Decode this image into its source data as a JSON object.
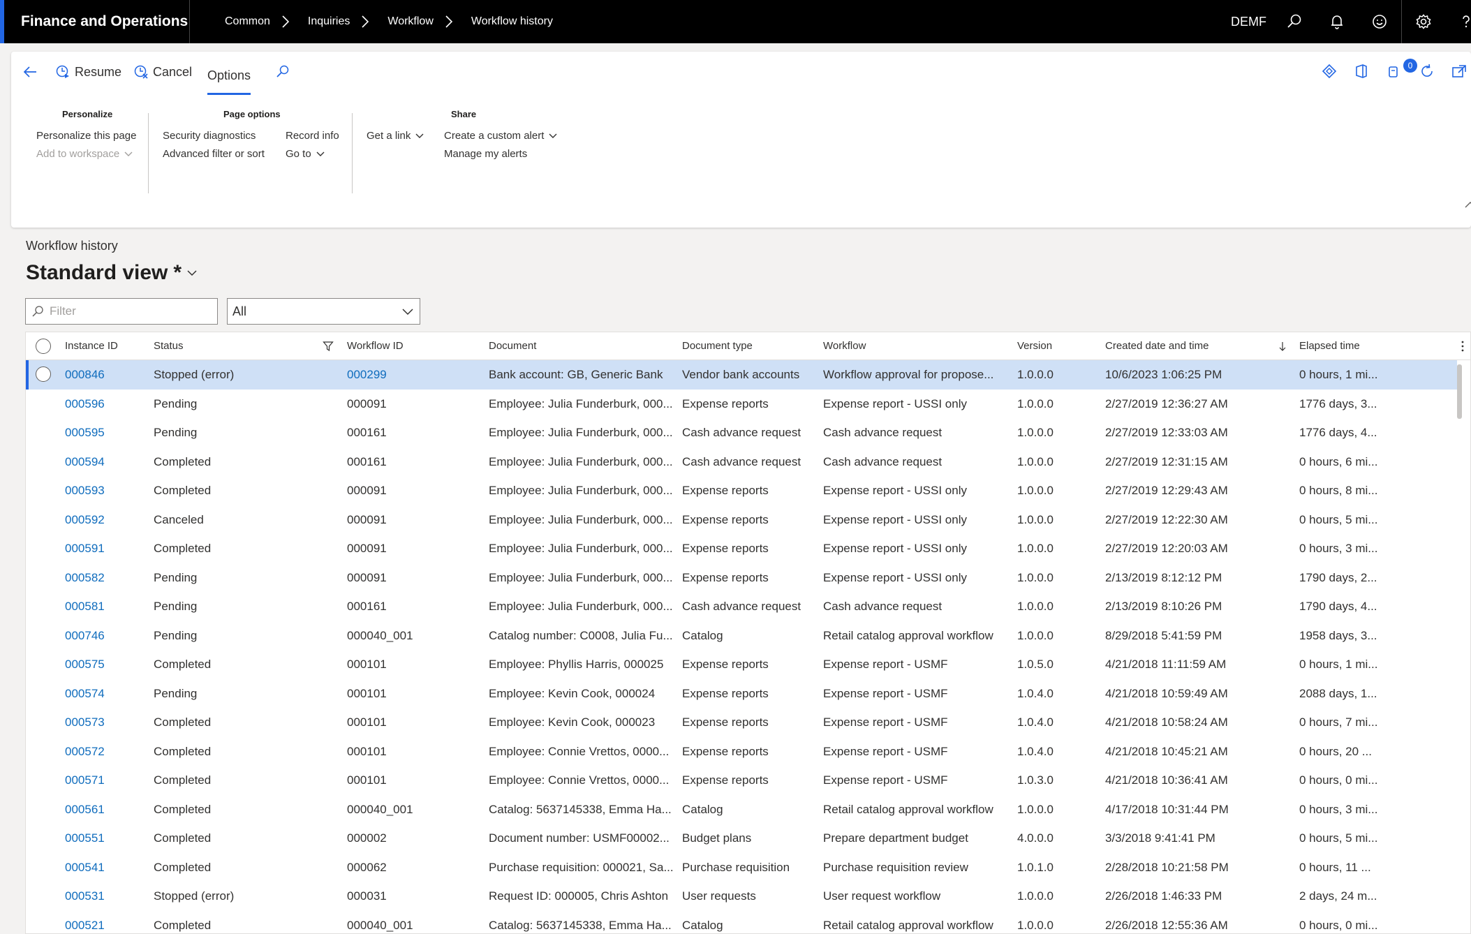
{
  "app": {
    "title": "Finance and Operations",
    "company": "DEMF",
    "breadcrumb": [
      "Common",
      "Inquiries",
      "Workflow",
      "Workflow history"
    ]
  },
  "actions": {
    "resume": "Resume",
    "cancel": "Cancel",
    "options": "Options",
    "notification_count": "0"
  },
  "ribbon": {
    "personalize": {
      "title": "Personalize",
      "personalize_page": "Personalize this page",
      "add_to_workspace": "Add to workspace"
    },
    "page_options": {
      "title": "Page options",
      "security_diagnostics": "Security diagnostics",
      "advanced_filter": "Advanced filter or sort",
      "record_info": "Record info",
      "go_to": "Go to"
    },
    "share_links": {
      "get_a_link": "Get a link"
    },
    "share": {
      "title": "Share",
      "create_alert": "Create a custom alert",
      "manage_alerts": "Manage my alerts"
    }
  },
  "page": {
    "caption": "Workflow history",
    "view_name": "Standard view",
    "view_modified": "*",
    "filter_placeholder": "Filter",
    "status_filter": "All"
  },
  "grid": {
    "columns": {
      "instance_id": "Instance ID",
      "status": "Status",
      "workflow_id": "Workflow ID",
      "document": "Document",
      "document_type": "Document type",
      "workflow": "Workflow",
      "version": "Version",
      "created": "Created date and time",
      "elapsed": "Elapsed time"
    },
    "rows": [
      {
        "id": "000846",
        "status": "Stopped (error)",
        "wf": "000299",
        "doc": "Bank account: GB, Generic Bank",
        "type": "Vendor bank accounts",
        "workflow": "Workflow approval for propose...",
        "ver": "1.0.0.0",
        "created": "10/6/2023 1:06:25 PM",
        "elapsed": "0 hours, 1 mi..."
      },
      {
        "id": "000596",
        "status": "Pending",
        "wf": "000091",
        "doc": "Employee: Julia Funderburk, 000...",
        "type": "Expense reports",
        "workflow": "Expense report - USSI only",
        "ver": "1.0.0.0",
        "created": "2/27/2019 12:36:27 AM",
        "elapsed": "1776 days, 3..."
      },
      {
        "id": "000595",
        "status": "Pending",
        "wf": "000161",
        "doc": "Employee: Julia Funderburk, 000...",
        "type": "Cash advance request",
        "workflow": "Cash advance request",
        "ver": "1.0.0.0",
        "created": "2/27/2019 12:33:03 AM",
        "elapsed": "1776 days, 4..."
      },
      {
        "id": "000594",
        "status": "Completed",
        "wf": "000161",
        "doc": "Employee: Julia Funderburk, 000...",
        "type": "Cash advance request",
        "workflow": "Cash advance request",
        "ver": "1.0.0.0",
        "created": "2/27/2019 12:31:15 AM",
        "elapsed": "0 hours, 6 mi..."
      },
      {
        "id": "000593",
        "status": "Completed",
        "wf": "000091",
        "doc": "Employee: Julia Funderburk, 000...",
        "type": "Expense reports",
        "workflow": "Expense report - USSI only",
        "ver": "1.0.0.0",
        "created": "2/27/2019 12:29:43 AM",
        "elapsed": "0 hours, 8 mi..."
      },
      {
        "id": "000592",
        "status": "Canceled",
        "wf": "000091",
        "doc": "Employee: Julia Funderburk, 000...",
        "type": "Expense reports",
        "workflow": "Expense report - USSI only",
        "ver": "1.0.0.0",
        "created": "2/27/2019 12:22:30 AM",
        "elapsed": "0 hours, 5 mi..."
      },
      {
        "id": "000591",
        "status": "Completed",
        "wf": "000091",
        "doc": "Employee: Julia Funderburk, 000...",
        "type": "Expense reports",
        "workflow": "Expense report - USSI only",
        "ver": "1.0.0.0",
        "created": "2/27/2019 12:20:03 AM",
        "elapsed": "0 hours, 3 mi..."
      },
      {
        "id": "000582",
        "status": "Pending",
        "wf": "000091",
        "doc": "Employee: Julia Funderburk, 000...",
        "type": "Expense reports",
        "workflow": "Expense report - USSI only",
        "ver": "1.0.0.0",
        "created": "2/13/2019 8:12:12 PM",
        "elapsed": "1790 days, 2..."
      },
      {
        "id": "000581",
        "status": "Pending",
        "wf": "000161",
        "doc": "Employee: Julia Funderburk, 000...",
        "type": "Cash advance request",
        "workflow": "Cash advance request",
        "ver": "1.0.0.0",
        "created": "2/13/2019 8:10:26 PM",
        "elapsed": "1790 days, 4..."
      },
      {
        "id": "000746",
        "status": "Pending",
        "wf": "000040_001",
        "doc": "Catalog number: C0008, Julia Fu...",
        "type": "Catalog",
        "workflow": "Retail catalog approval workflow",
        "ver": "1.0.0.0",
        "created": "8/29/2018 5:41:59 PM",
        "elapsed": "1958 days, 3..."
      },
      {
        "id": "000575",
        "status": "Completed",
        "wf": "000101",
        "doc": "Employee: Phyllis Harris, 000025",
        "type": "Expense reports",
        "workflow": "Expense report - USMF",
        "ver": "1.0.5.0",
        "created": "4/21/2018 11:11:59 AM",
        "elapsed": "0 hours, 1 mi..."
      },
      {
        "id": "000574",
        "status": "Pending",
        "wf": "000101",
        "doc": "Employee: Kevin Cook, 000024",
        "type": "Expense reports",
        "workflow": "Expense report - USMF",
        "ver": "1.0.4.0",
        "created": "4/21/2018 10:59:49 AM",
        "elapsed": "2088 days, 1..."
      },
      {
        "id": "000573",
        "status": "Completed",
        "wf": "000101",
        "doc": "Employee: Kevin Cook, 000023",
        "type": "Expense reports",
        "workflow": "Expense report - USMF",
        "ver": "1.0.4.0",
        "created": "4/21/2018 10:58:24 AM",
        "elapsed": "0 hours, 7 mi..."
      },
      {
        "id": "000572",
        "status": "Completed",
        "wf": "000101",
        "doc": "Employee: Connie Vrettos, 0000...",
        "type": "Expense reports",
        "workflow": "Expense report - USMF",
        "ver": "1.0.4.0",
        "created": "4/21/2018 10:45:21 AM",
        "elapsed": "0 hours, 20 ..."
      },
      {
        "id": "000571",
        "status": "Completed",
        "wf": "000101",
        "doc": "Employee: Connie Vrettos, 0000...",
        "type": "Expense reports",
        "workflow": "Expense report - USMF",
        "ver": "1.0.3.0",
        "created": "4/21/2018 10:36:41 AM",
        "elapsed": "0 hours, 0 mi..."
      },
      {
        "id": "000561",
        "status": "Completed",
        "wf": "000040_001",
        "doc": "Catalog: 5637145338, Emma Ha...",
        "type": "Catalog",
        "workflow": "Retail catalog approval workflow",
        "ver": "1.0.0.0",
        "created": "4/17/2018 10:31:44 PM",
        "elapsed": "0 hours, 3 mi..."
      },
      {
        "id": "000551",
        "status": "Completed",
        "wf": "000002",
        "doc": "Document number: USMF00002...",
        "type": "Budget plans",
        "workflow": "Prepare department budget",
        "ver": "4.0.0.0",
        "created": "3/3/2018 9:41:41 PM",
        "elapsed": "0 hours, 5 mi..."
      },
      {
        "id": "000541",
        "status": "Completed",
        "wf": "000062",
        "doc": "Purchase requisition: 000021, Sa...",
        "type": "Purchase requisition",
        "workflow": "Purchase requisition review",
        "ver": "1.0.1.0",
        "created": "2/28/2018 10:21:58 PM",
        "elapsed": "0 hours, 11 ..."
      },
      {
        "id": "000531",
        "status": "Stopped (error)",
        "wf": "000031",
        "doc": "Request ID: 000005, Chris Ashton",
        "type": "User requests",
        "workflow": "User request workflow",
        "ver": "1.0.0.0",
        "created": "2/26/2018 1:46:33 PM",
        "elapsed": "2 days, 24 m..."
      },
      {
        "id": "000521",
        "status": "Completed",
        "wf": "000040_001",
        "doc": "Catalog: 5637145338, Emma Ha...",
        "type": "Catalog",
        "workflow": "Retail catalog approval workflow",
        "ver": "1.0.0.0",
        "created": "2/26/2018 12:55:36 AM",
        "elapsed": "0 hours, 0 mi..."
      }
    ]
  }
}
